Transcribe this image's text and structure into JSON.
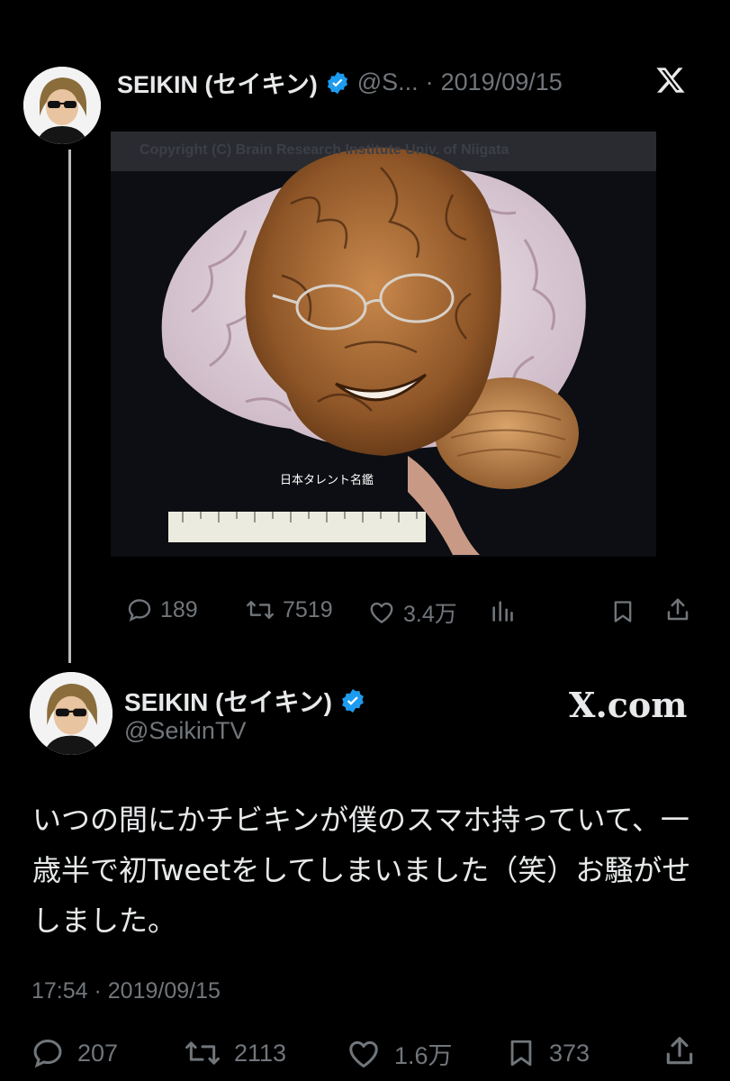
{
  "reply": {
    "author_name": "SEIKIN (セイキン)",
    "handle_truncated": "@S...",
    "separator": "·",
    "date": "2019/09/15",
    "image": {
      "watermark_text": "Copyright (C)  Brain Research Institute  Univ. of Niigata",
      "caption": "日本タレント名鑑"
    },
    "stats": {
      "replies": "189",
      "retweets": "7519",
      "likes": "3.4万"
    }
  },
  "main": {
    "author_name": "SEIKIN (セイキン)",
    "handle": "@SeikinTV",
    "source_badge": "X.com",
    "text": "いつの間にかチビキンが僕のスマホ持っていて、一歳半で初Tweetをしてしまいました（笑）お騒がせしました。",
    "timestamp": "17:54 · 2019/09/15",
    "stats": {
      "replies": "207",
      "retweets": "2113",
      "likes": "1.6万",
      "bookmarks": "373"
    }
  },
  "colors": {
    "background": "#000000",
    "text": "#e7e9ea",
    "muted": "#71767b",
    "verified": "#1d9bf0"
  },
  "icons": [
    "x-logo-icon",
    "verified-badge-icon",
    "reply-icon",
    "retweet-icon",
    "like-icon",
    "views-icon",
    "bookmark-icon",
    "share-icon"
  ]
}
